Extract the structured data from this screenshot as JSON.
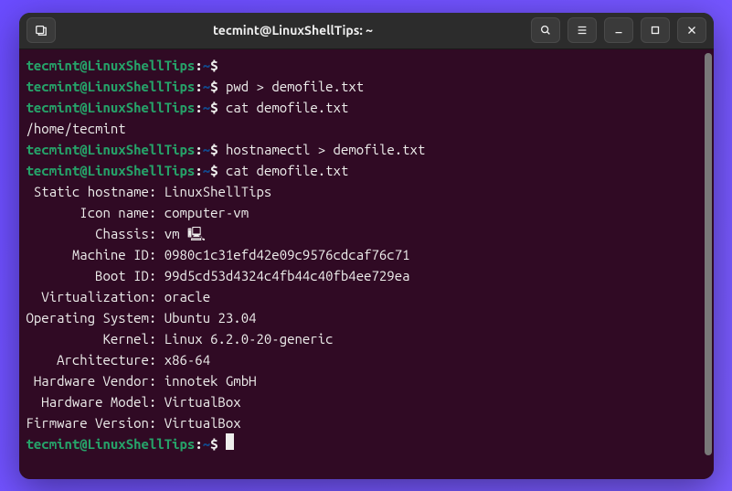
{
  "window": {
    "title": "tecmint@LinuxShellTips: ~"
  },
  "prompt": {
    "user_host": "tecmint@LinuxShellTips",
    "separator": ":",
    "path": "~",
    "symbol": "$"
  },
  "lines": [
    {
      "type": "prompt",
      "cmd": ""
    },
    {
      "type": "prompt",
      "cmd": "pwd > demofile.txt"
    },
    {
      "type": "prompt",
      "cmd": "cat demofile.txt"
    },
    {
      "type": "output",
      "text": "/home/tecmint"
    },
    {
      "type": "prompt",
      "cmd": "hostnamectl > demofile.txt"
    },
    {
      "type": "prompt",
      "cmd": "cat demofile.txt"
    },
    {
      "type": "output",
      "text": " Static hostname: LinuxShellTips"
    },
    {
      "type": "output",
      "text": "       Icon name: computer-vm"
    },
    {
      "type": "output",
      "text": "         Chassis: vm 🖳"
    },
    {
      "type": "output",
      "text": "      Machine ID: 0980c1c31efd42e09c9576cdcaf76c71"
    },
    {
      "type": "output",
      "text": "         Boot ID: 99d5cd53d4324c4fb44c40fb4ee729ea"
    },
    {
      "type": "output",
      "text": "  Virtualization: oracle"
    },
    {
      "type": "output",
      "text": "Operating System: Ubuntu 23.04"
    },
    {
      "type": "output",
      "text": "          Kernel: Linux 6.2.0-20-generic"
    },
    {
      "type": "output",
      "text": "    Architecture: x86-64"
    },
    {
      "type": "output",
      "text": " Hardware Vendor: innotek GmbH"
    },
    {
      "type": "output",
      "text": "  Hardware Model: VirtualBox"
    },
    {
      "type": "output",
      "text": "Firmware Version: VirtualBox"
    },
    {
      "type": "prompt-cursor",
      "cmd": ""
    }
  ]
}
